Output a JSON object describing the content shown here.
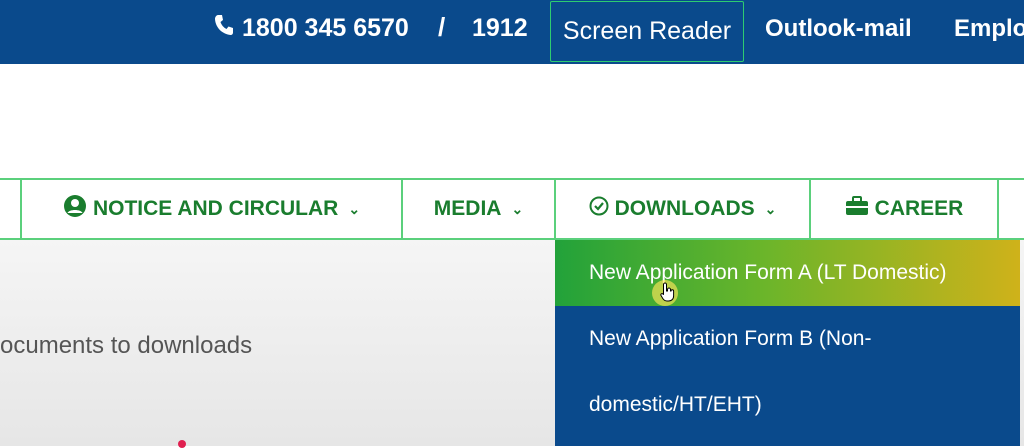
{
  "topbar": {
    "phone": "1800 345 6570",
    "separator": "/",
    "alt_number": "1912",
    "screen_reader": "Screen Reader",
    "outlook": "Outlook-mail",
    "employee": "Emplo"
  },
  "nav": {
    "items": [
      {
        "label": "NOTICE AND CIRCULAR",
        "icon": "user-circle-icon"
      },
      {
        "label": "MEDIA"
      },
      {
        "label": "DOWNLOADS",
        "icon": "check-circle-icon"
      },
      {
        "label": "CAREER",
        "icon": "briefcase-icon"
      }
    ]
  },
  "content": {
    "text": "ocuments to downloads"
  },
  "dropdown": {
    "items": [
      "New Application Form A (LT Domestic)",
      "New Application Form B (Non-domestic/HT/EHT)"
    ]
  },
  "colors": {
    "primary_blue": "#0a4a8c",
    "nav_green": "#1a7d2e",
    "border_green": "#5bd07c"
  }
}
